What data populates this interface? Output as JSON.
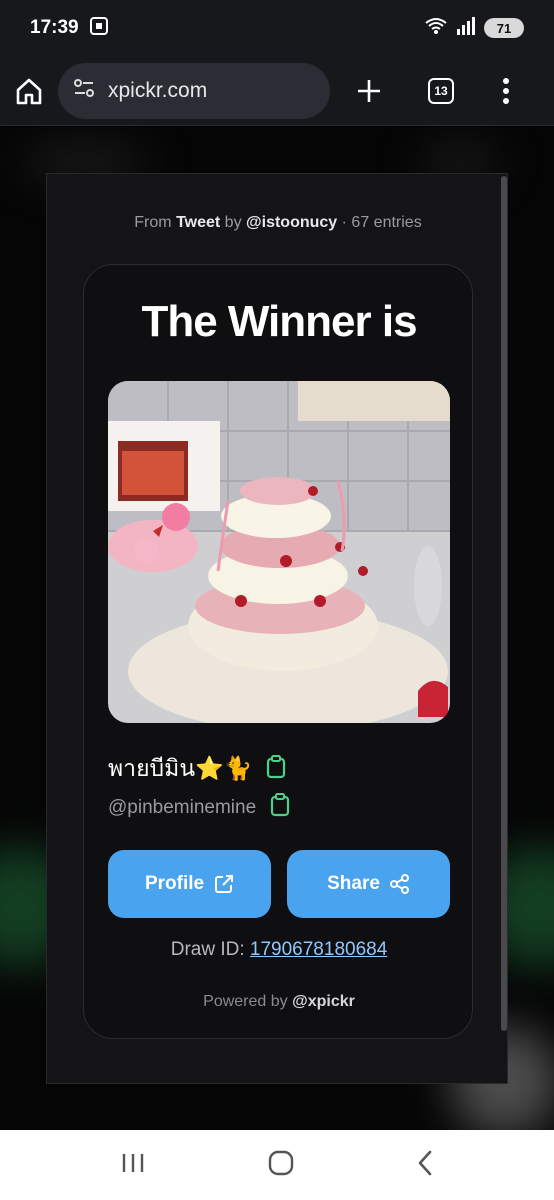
{
  "status_bar": {
    "time": "17:39",
    "battery": "71"
  },
  "browser": {
    "url": "xpickr.com",
    "tab_count": "13"
  },
  "modal": {
    "from_prefix": "From",
    "source": "Tweet",
    "by_word": "by",
    "author": "@istoonucy",
    "entries": "· 67 entries",
    "title": "The Winner is",
    "winner_name": "พายบีมิน⭐🐈",
    "winner_handle": "@pinbeminemine",
    "profile_label": "Profile",
    "share_label": "Share",
    "draw_id_label": "Draw ID:",
    "draw_id_value": "1790678180684",
    "powered_prefix": "Powered by",
    "powered_brand": "@xpickr"
  },
  "colors": {
    "accent": "#4aa3ee",
    "link": "#8fc8ff",
    "copy_icon": "#4fd08a"
  }
}
